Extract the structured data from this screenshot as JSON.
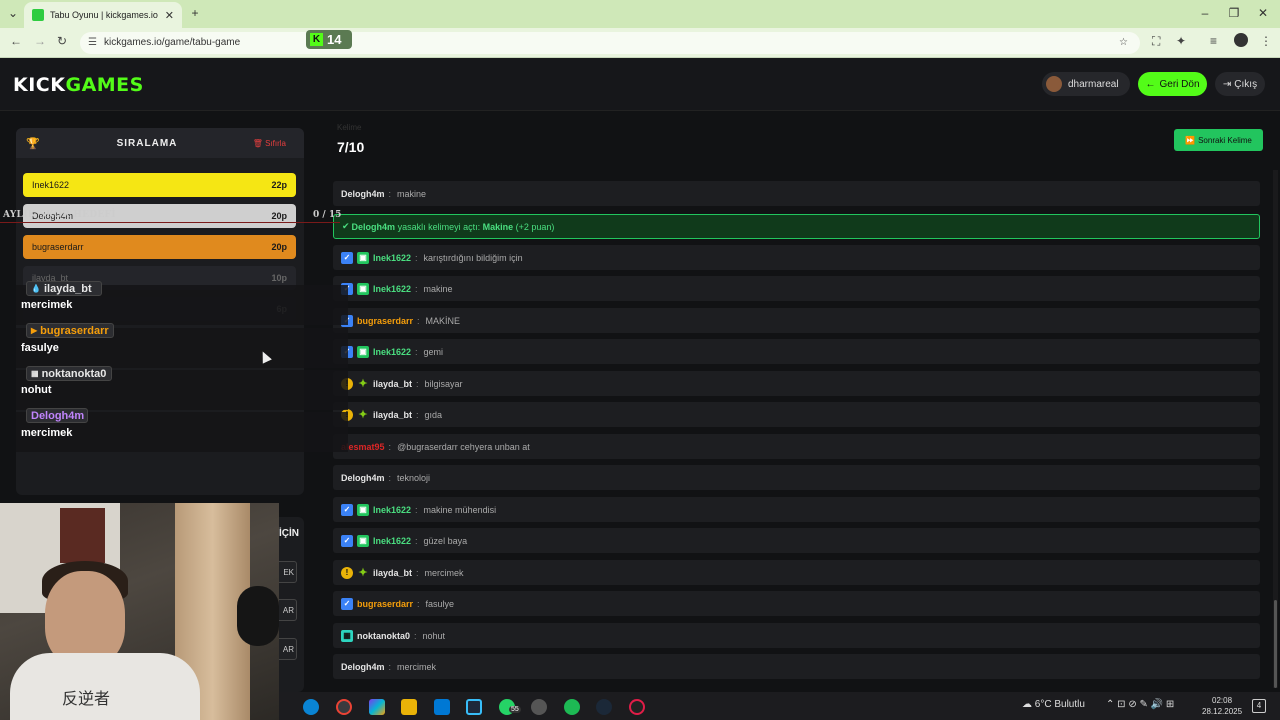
{
  "browser": {
    "tab_title": "Tabu Oyunu | kickgames.io",
    "url": "kickgames.io/game/tabu-game",
    "kick_count": "14"
  },
  "header": {
    "logo_main": "KICK",
    "logo_accent": "GAMES",
    "username": "dharmareal",
    "back_label": "Geri Dön",
    "logout_label": "Çıkış"
  },
  "leaderboard": {
    "title": "SIRALAMA",
    "reset_label": "Sıfırla",
    "rows": [
      {
        "name": "Inek1622",
        "points": "22p",
        "color": "#f5e614"
      },
      {
        "name": "Delogh4m",
        "points": "20p",
        "color": "#cfcfcf"
      },
      {
        "name": "bugraserdarr",
        "points": "20p",
        "color": "#e08a1e"
      },
      {
        "name": "ilayda_bt",
        "points": "10p",
        "color": "#24252a"
      },
      {
        "name": "",
        "points": "6p",
        "color": "#1e1f22"
      }
    ]
  },
  "overlay": {
    "monthly_label": "AYLIK SKOR HEDEFİ",
    "monthly_score": "0 / 15",
    "entries": [
      {
        "user": "ilayda_bt",
        "word": "mercimek",
        "color": "#e7e7e7"
      },
      {
        "user": "bugraserdarr",
        "word": "fasulye",
        "color": "#f59e0b"
      },
      {
        "user": "noktanokta0",
        "word": "nohut",
        "color": "#e7e7e7"
      },
      {
        "user": "Delogh4m",
        "word": "mercimek",
        "color": "#c084fc"
      }
    ]
  },
  "round": {
    "label": "Kelime",
    "value": "7/10",
    "next_label": "Sonraki Kelime"
  },
  "system_message": {
    "user": "Delogh4m",
    "text": " yasaklı kelimeyi açtı: ",
    "word": "Makine",
    "bonus": " (+2 puan)"
  },
  "chat": [
    {
      "user": "Delogh4m",
      "text": "makine",
      "color": "#e5e5e5",
      "icons": []
    },
    {
      "user": "Inek1622",
      "text": "karıştırdığını bildiğim için",
      "color": "#4ade80",
      "icons": [
        "v",
        "g"
      ]
    },
    {
      "user": "Inek1622",
      "text": "makine",
      "color": "#4ade80",
      "icons": [
        "v",
        "g"
      ]
    },
    {
      "user": "bugraserdarr",
      "text": "MAKİNE",
      "color": "#f59e0b",
      "icons": [
        "v"
      ]
    },
    {
      "user": "Inek1622",
      "text": "gemi",
      "color": "#4ade80",
      "icons": [
        "v",
        "g"
      ]
    },
    {
      "user": "ilayda_bt",
      "text": "bilgisayar",
      "color": "#e5e5e5",
      "icons": [
        "c",
        "s"
      ]
    },
    {
      "user": "ilayda_bt",
      "text": "gıda",
      "color": "#e5e5e5",
      "icons": [
        "c",
        "s"
      ]
    },
    {
      "user": "alesmat95",
      "text": "@bugraserdarr cehyera unban at",
      "color": "#dc2626",
      "icons": []
    },
    {
      "user": "Delogh4m",
      "text": "teknoloji",
      "color": "#e5e5e5",
      "icons": []
    },
    {
      "user": "Inek1622",
      "text": "makine mühendisi",
      "color": "#4ade80",
      "icons": [
        "v",
        "g"
      ]
    },
    {
      "user": "Inek1622",
      "text": "güzel baya",
      "color": "#4ade80",
      "icons": [
        "v",
        "g"
      ]
    },
    {
      "user": "ilayda_bt",
      "text": "mercimek",
      "color": "#e5e5e5",
      "icons": [
        "c",
        "s"
      ]
    },
    {
      "user": "bugraserdarr",
      "text": "fasulye",
      "color": "#f59e0b",
      "icons": [
        "v"
      ]
    },
    {
      "user": "noktanokta0",
      "text": "nohut",
      "color": "#e5e5e5",
      "icons": [
        "n"
      ]
    },
    {
      "user": "Delogh4m",
      "text": "mercimek",
      "color": "#e5e5e5",
      "icons": []
    }
  ],
  "side_panel": {
    "heading": "İÇİN",
    "chips": [
      "EK",
      "AR",
      "AR"
    ]
  },
  "webcam": {
    "shirt_text": "反逆者"
  },
  "taskbar": {
    "weather": "6°C Bulutlu",
    "time": "02:08",
    "date": "28.12.2025",
    "notif_count": "4",
    "whatsapp_badge": "55"
  }
}
